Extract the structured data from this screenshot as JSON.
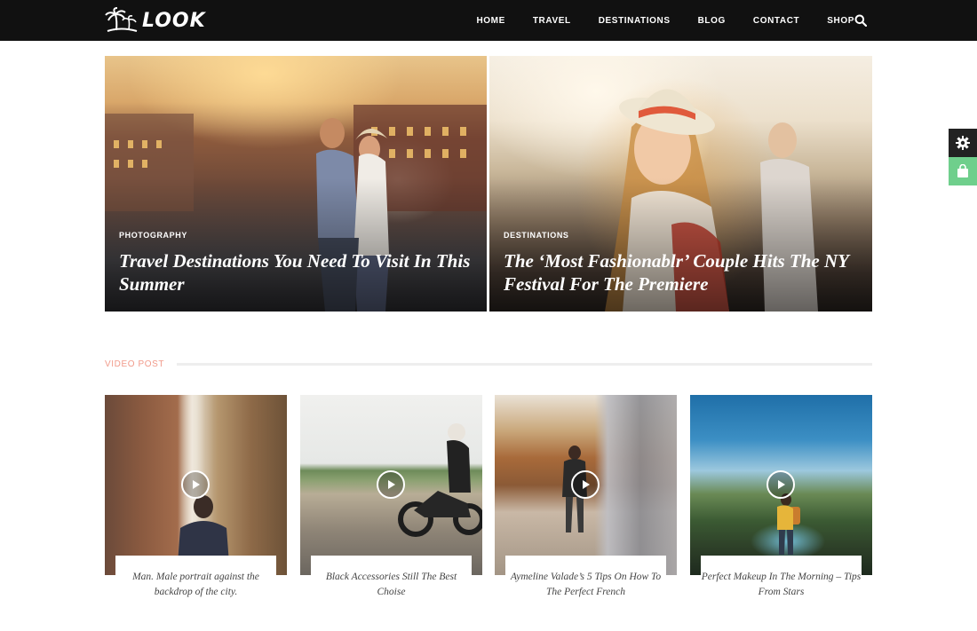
{
  "brand": {
    "name": "LOOK"
  },
  "nav": {
    "items": [
      "HOME",
      "TRAVEL",
      "DESTINATIONS",
      "BLOG",
      "CONTACT",
      "SHOP"
    ],
    "search_icon": "search-icon"
  },
  "side_widget": {
    "icons": [
      "gear-icon",
      "shopping-bag-icon"
    ],
    "colors": {
      "dark": "#222222",
      "green": "#6fcf8c"
    }
  },
  "featured": [
    {
      "category": "PHOTOGRAPHY",
      "title": "Travel Destinations You Need To Visit In This Summer"
    },
    {
      "category": "DESTINATIONS",
      "title": "The ‘Most Fashionablr’ Couple Hits The NY Festival For The Premiere"
    }
  ],
  "video_section": {
    "label": "VIDEO POST",
    "posts": [
      {
        "title": "Man. Male portrait against the backdrop of the city."
      },
      {
        "title": "Black Accessories Still The Best Choise"
      },
      {
        "title": "Aymeline Valade’s 5 Tips On How To The Perfect French"
      },
      {
        "title": "Perfect Makeup In The Morning – Tips From Stars"
      }
    ]
  },
  "colors": {
    "topbar": "#111111",
    "accent": "#f19a8a"
  }
}
